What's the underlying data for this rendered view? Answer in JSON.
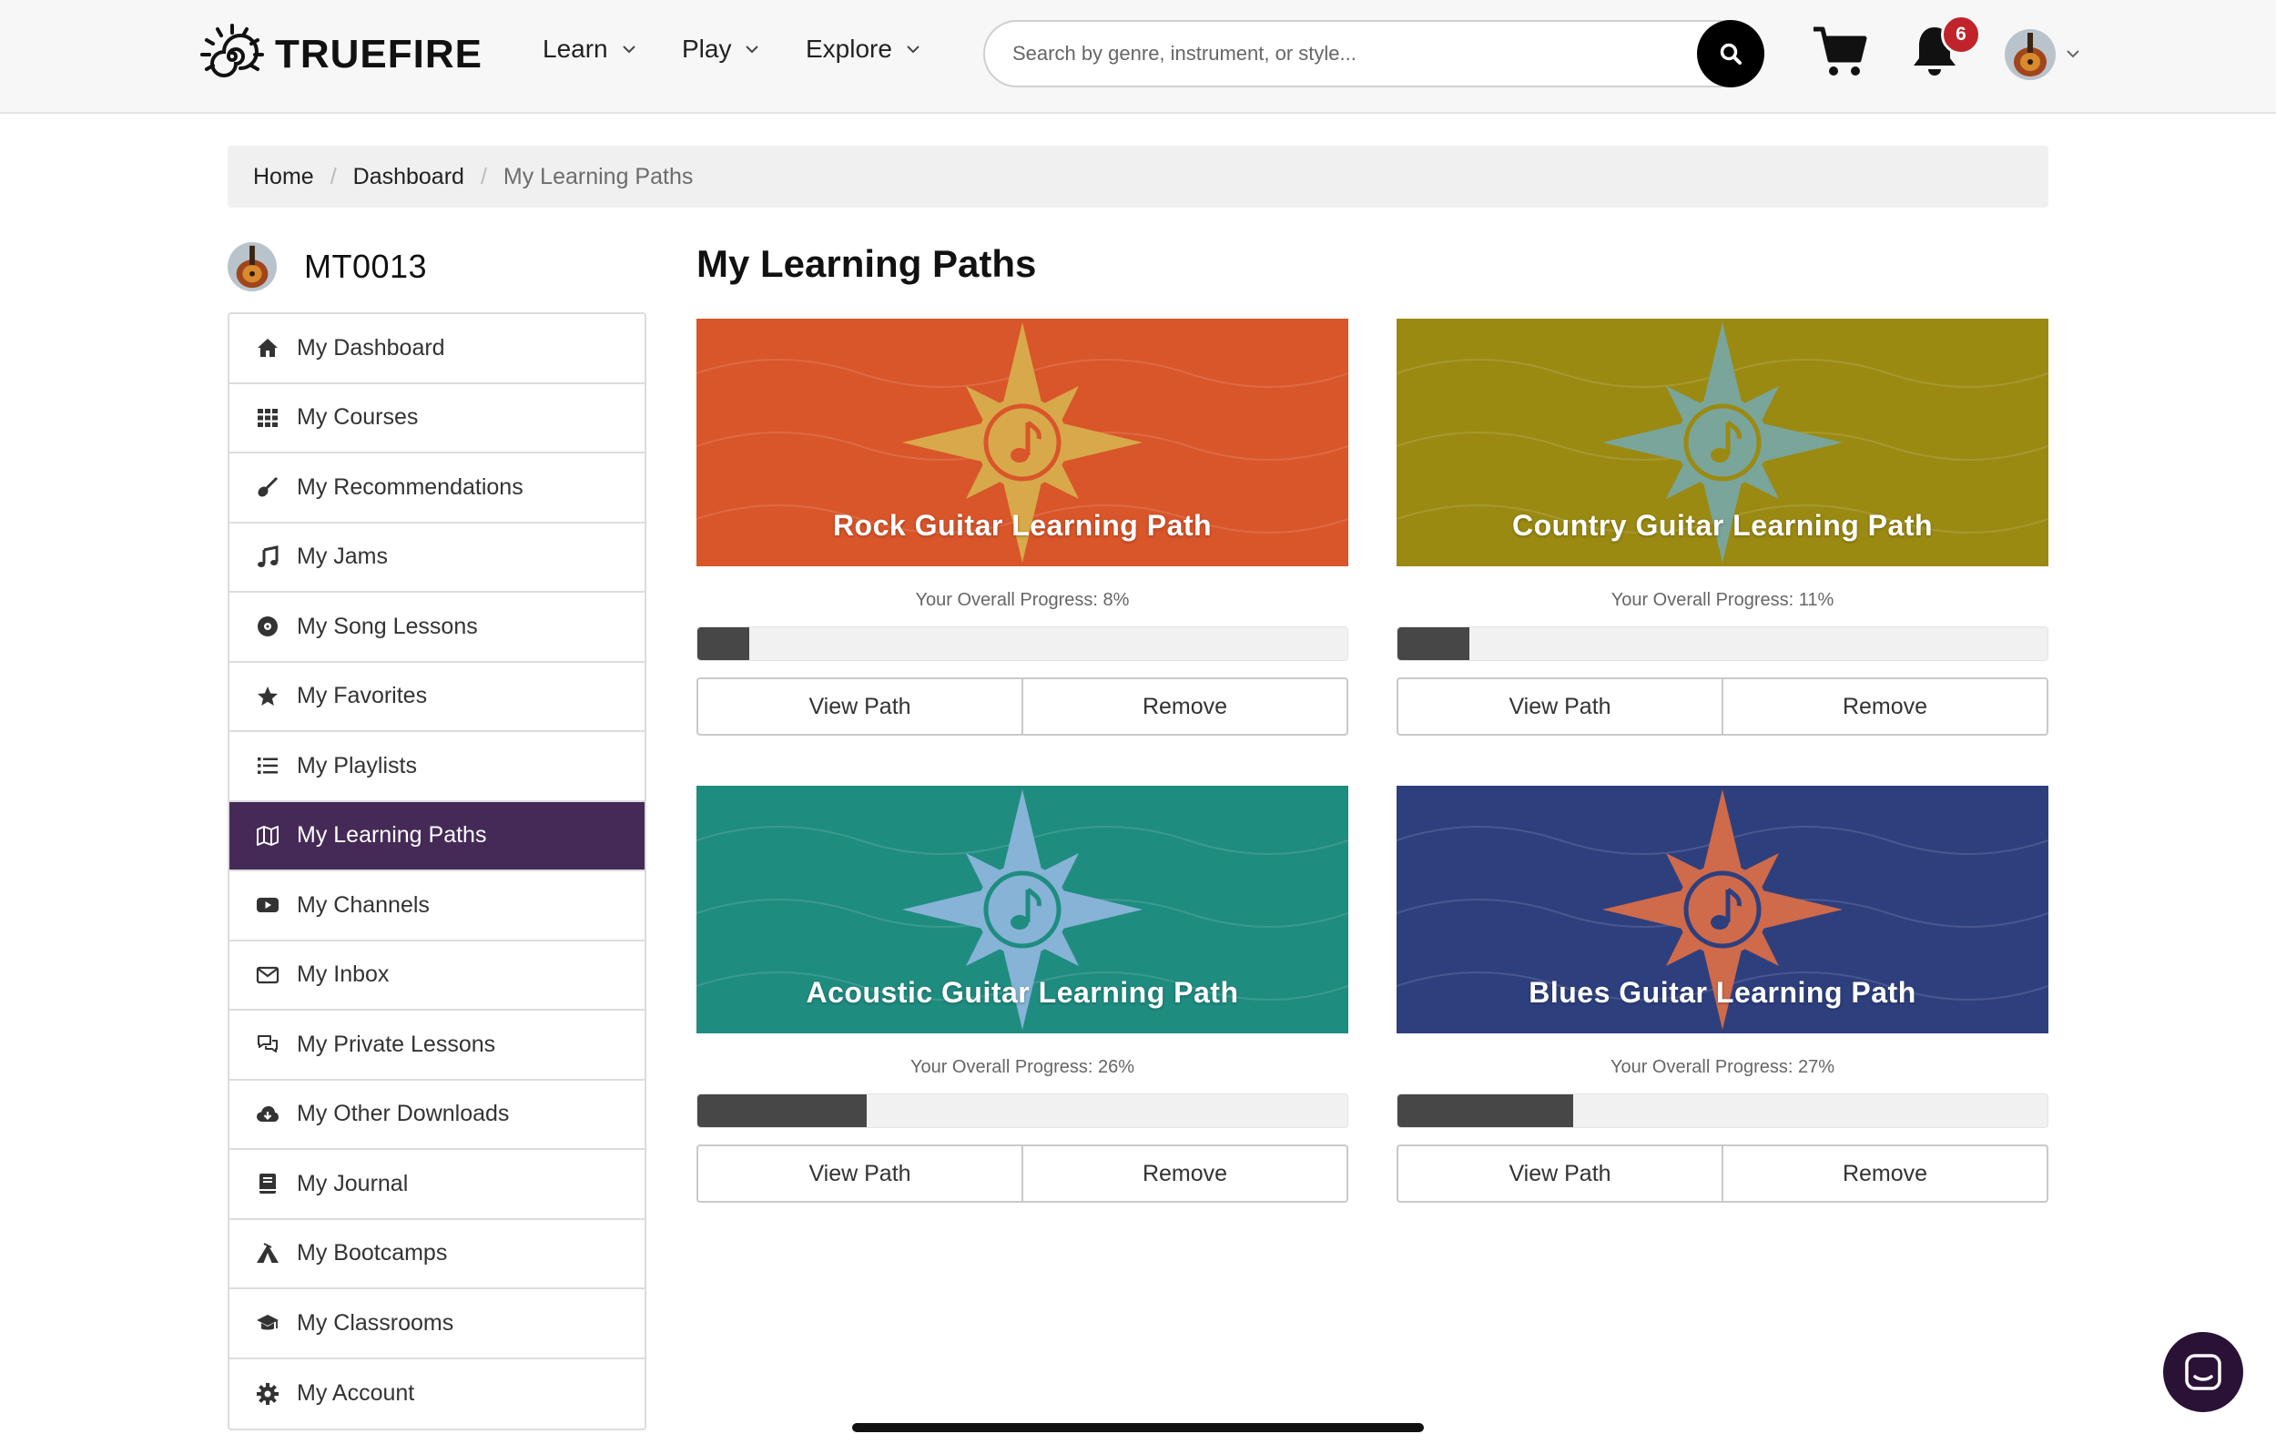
{
  "header": {
    "logo_text": "TRUEFIRE",
    "nav": [
      {
        "label": "Learn"
      },
      {
        "label": "Play"
      },
      {
        "label": "Explore"
      }
    ],
    "search_placeholder": "Search by genre, instrument, or style...",
    "notification_count": "6"
  },
  "breadcrumb": {
    "home": "Home",
    "dashboard": "Dashboard",
    "current": "My Learning Paths"
  },
  "user": {
    "name": "MT0013"
  },
  "sidebar": {
    "items": [
      {
        "label": "My Dashboard",
        "icon": "home-icon"
      },
      {
        "label": "My Courses",
        "icon": "grid-icon"
      },
      {
        "label": "My Recommendations",
        "icon": "guitar-icon"
      },
      {
        "label": "My Jams",
        "icon": "music-note-icon"
      },
      {
        "label": "My Song Lessons",
        "icon": "record-icon"
      },
      {
        "label": "My Favorites",
        "icon": "star-icon"
      },
      {
        "label": "My Playlists",
        "icon": "list-icon"
      },
      {
        "label": "My Learning Paths",
        "icon": "map-icon",
        "active": true
      },
      {
        "label": "My Channels",
        "icon": "youtube-icon"
      },
      {
        "label": "My Inbox",
        "icon": "envelope-icon"
      },
      {
        "label": "My Private Lessons",
        "icon": "chat-bubbles-icon"
      },
      {
        "label": "My Other Downloads",
        "icon": "cloud-download-icon"
      },
      {
        "label": "My Journal",
        "icon": "book-icon"
      },
      {
        "label": "My Bootcamps",
        "icon": "tent-icon"
      },
      {
        "label": "My Classrooms",
        "icon": "graduation-cap-icon"
      },
      {
        "label": "My Account",
        "icon": "gear-icon"
      }
    ]
  },
  "main": {
    "title": "My Learning Paths",
    "paths": [
      {
        "title": "Rock Guitar Learning Path",
        "progress_label": "Your Overall Progress: 8%",
        "progress": 8,
        "bg": "#d9552a",
        "star": "#d8a94a",
        "view_label": "View Path",
        "remove_label": "Remove"
      },
      {
        "title": "Country Guitar Learning Path",
        "progress_label": "Your Overall Progress: 11%",
        "progress": 11,
        "bg": "#9a8a12",
        "star": "#7aa59a",
        "view_label": "View Path",
        "remove_label": "Remove"
      },
      {
        "title": "Acoustic Guitar Learning Path",
        "progress_label": "Your Overall Progress: 26%",
        "progress": 26,
        "bg": "#1f8c80",
        "star": "#86b3d6",
        "view_label": "View Path",
        "remove_label": "Remove"
      },
      {
        "title": "Blues Guitar Learning Path",
        "progress_label": "Your Overall Progress: 27%",
        "progress": 27,
        "bg": "#2e3f7e",
        "star": "#cf6a4a",
        "view_label": "View Path",
        "remove_label": "Remove"
      }
    ]
  },
  "colors": {
    "accent": "#452a57",
    "badge": "#c0242a",
    "progress_fill": "#474747"
  }
}
